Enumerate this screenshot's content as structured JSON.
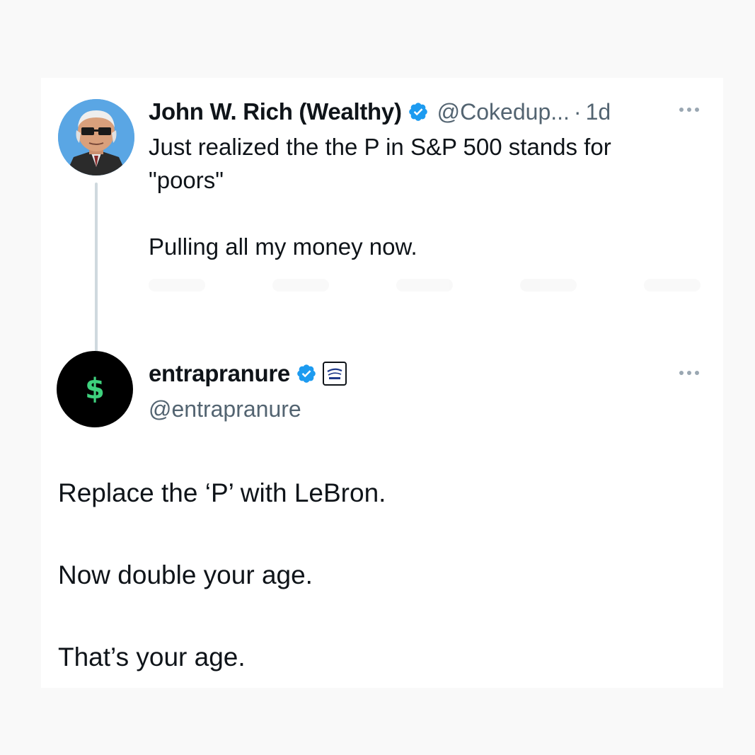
{
  "tweet1": {
    "name": "John W. Rich (Wealthy)",
    "handle": "@Cokedup...",
    "separator": "·",
    "time": "1d",
    "text": "Just realized the the P in S&P 500 stands for\n\"poors\"\n\nPulling all my money now.",
    "avatar_icon": "cartoon-old-man-avatar",
    "verified_icon": "verified-badge-icon"
  },
  "tweet2": {
    "name": "entrapranure",
    "handle": "@entrapranure",
    "text": "Replace the ‘P’ with LeBron.\n\nNow double your age.\n\nThat’s your age.",
    "avatar_symbol": "$",
    "verified_icon": "verified-badge-icon",
    "affiliation_icon": "friday-beers-badge-icon"
  },
  "colors": {
    "background": "#f9f9f9",
    "card": "#ffffff",
    "text": "#0f1419",
    "secondary": "#536471",
    "verified": "#1d9bf0",
    "dollar_green": "#3ed17d",
    "thread_line": "#cfd9de"
  }
}
